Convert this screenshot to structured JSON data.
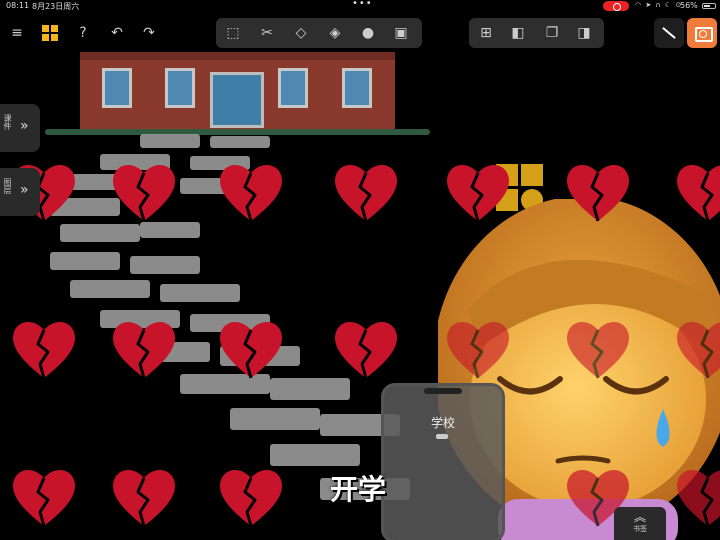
{
  "status_bar": {
    "time": "08:11",
    "date": "8月23日周六",
    "more_dots": "•••",
    "battery": "56%",
    "battery_fraction": 0.56,
    "record_color": "#ee2222"
  },
  "toolbar": {
    "icons": {
      "menu": "hamburger-icon",
      "apps": "grid-icon",
      "help": "question-icon",
      "undo": "undo-icon",
      "redo": "redo-icon",
      "select": "selection-icon",
      "cut": "scissors-icon",
      "eraser": "eraser-icon",
      "fill": "paint-bucket-icon",
      "shape": "circle-icon",
      "image": "image-add-icon",
      "add_page": "add-page-icon",
      "split": "split-icon",
      "copy": "copy-icon",
      "mirror": "mirror-icon",
      "pen": "pencil-icon",
      "camera": "camera-icon"
    },
    "accent_color": "#f07c3c",
    "apps_color": "#f5b31e"
  },
  "side_tabs": [
    {
      "label": "课件"
    },
    {
      "label": "图层"
    }
  ],
  "phone": {
    "title": "学校"
  },
  "caption": "开学",
  "bookmark": {
    "label": "书签"
  }
}
